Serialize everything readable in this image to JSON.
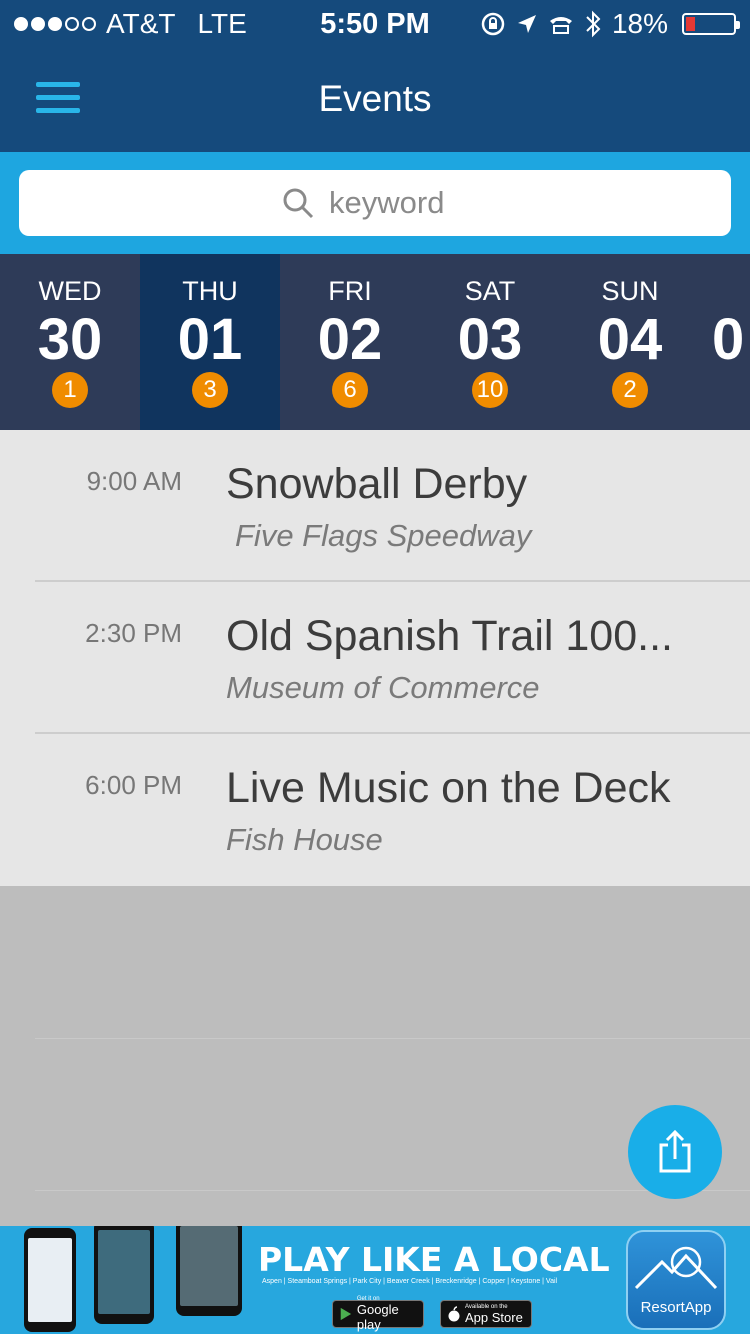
{
  "status_bar": {
    "carrier": "AT&T",
    "network": "LTE",
    "time": "5:50 PM",
    "battery": "18%",
    "battery_level": 0.18
  },
  "header": {
    "title": "Events"
  },
  "search": {
    "placeholder": "keyword"
  },
  "days": [
    {
      "dow": "WED",
      "num": "30",
      "count": "1"
    },
    {
      "dow": "THU",
      "num": "01",
      "count": "3",
      "active": true
    },
    {
      "dow": "FRI",
      "num": "02",
      "count": "6"
    },
    {
      "dow": "SAT",
      "num": "03",
      "count": "10"
    },
    {
      "dow": "SUN",
      "num": "04",
      "count": "2"
    },
    {
      "dow": "",
      "num": "0",
      "count": ""
    }
  ],
  "events": [
    {
      "time": "9:00 AM",
      "title": "Snowball Derby",
      "venue": "Five Flags Speedway"
    },
    {
      "time": "2:30 PM",
      "title": "Old Spanish Trail 100...",
      "venue": "Museum of Commerce"
    },
    {
      "time": "6:00 PM",
      "title": "Live Music on the Deck",
      "venue": "Fish House"
    }
  ],
  "ad": {
    "headline": "PLAY LIKE A LOCAL",
    "locations": "Aspen | Steamboat Springs | Park City | Beaver Creek | Breckenridge | Copper | Keystone | Vail",
    "google_small": "Get it on",
    "google_big": "Google play",
    "apple_small": "Available on the",
    "apple_big": "App Store",
    "app_name": "ResortApp"
  },
  "colors": {
    "nav_bg": "#154a7c",
    "search_bg": "#1ea6e0",
    "days_bg": "#2e3b58",
    "active_day": "#10345e",
    "badge": "#f08c00",
    "accent": "#19aee8"
  }
}
